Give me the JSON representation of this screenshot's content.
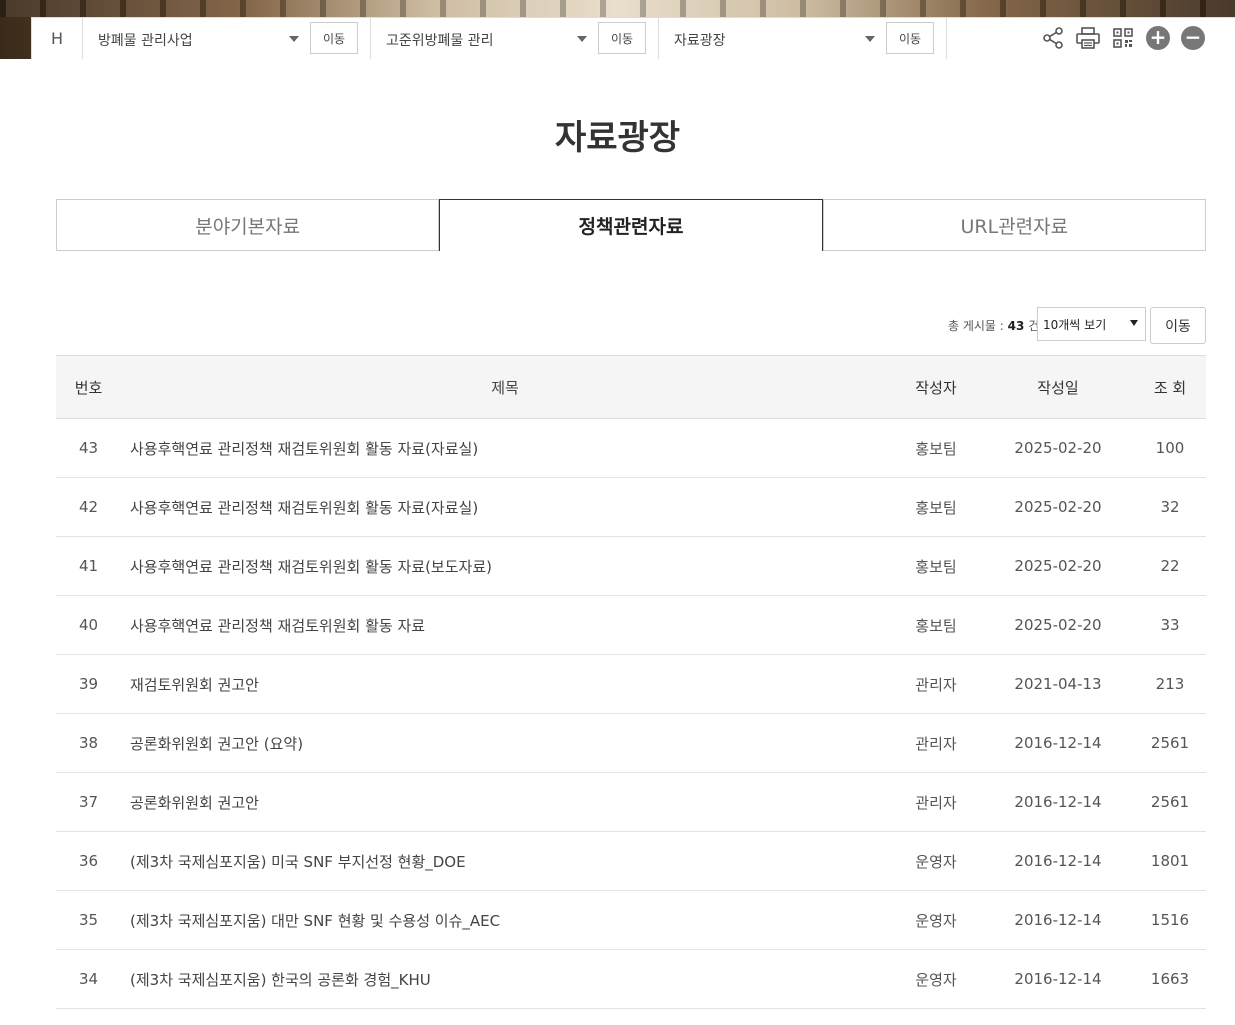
{
  "nav": {
    "home": "H",
    "selects": [
      {
        "label": "방폐물 관리사업",
        "go": "이동"
      },
      {
        "label": "고준위방폐물 관리",
        "go": "이동"
      },
      {
        "label": "자료광장",
        "go": "이동"
      }
    ],
    "zoom_in": "+",
    "zoom_out": "−"
  },
  "page_title": "자료광장",
  "tabs": [
    "분야기본자료",
    "정책관련자료",
    "URL관련자료"
  ],
  "list_info": {
    "prefix": "총 게시물 :",
    "count": "43",
    "suffix": "건",
    "page_size": "10개씩 보기",
    "go": "이동"
  },
  "table": {
    "headers": [
      "번호",
      "제목",
      "작성자",
      "작성일",
      "조 회"
    ],
    "rows": [
      {
        "no": "43",
        "title": "사용후핵연료 관리정책 재검토위원회 활동 자료(자료실)",
        "author": "홍보팀",
        "date": "2025-02-20",
        "views": "100"
      },
      {
        "no": "42",
        "title": "사용후핵연료 관리정책 재검토위원회 활동 자료(자료실)",
        "author": "홍보팀",
        "date": "2025-02-20",
        "views": "32"
      },
      {
        "no": "41",
        "title": "사용후핵연료 관리정책 재검토위원회 활동 자료(보도자료)",
        "author": "홍보팀",
        "date": "2025-02-20",
        "views": "22"
      },
      {
        "no": "40",
        "title": "사용후핵연료 관리정책 재검토위원회 활동 자료",
        "author": "홍보팀",
        "date": "2025-02-20",
        "views": "33"
      },
      {
        "no": "39",
        "title": "재검토위원회 권고안",
        "author": "관리자",
        "date": "2021-04-13",
        "views": "213"
      },
      {
        "no": "38",
        "title": "공론화위원회 권고안 (요약)",
        "author": "관리자",
        "date": "2016-12-14",
        "views": "2561"
      },
      {
        "no": "37",
        "title": "공론화위원회 권고안",
        "author": "관리자",
        "date": "2016-12-14",
        "views": "2561"
      },
      {
        "no": "36",
        "title": "(제3차 국제심포지움) 미국 SNF 부지선정 현황_DOE",
        "author": "운영자",
        "date": "2016-12-14",
        "views": "1801"
      },
      {
        "no": "35",
        "title": "(제3차 국제심포지움) 대만 SNF 현황 및 수용성 이슈_AEC",
        "author": "운영자",
        "date": "2016-12-14",
        "views": "1516"
      },
      {
        "no": "34",
        "title": "(제3차 국제심포지움) 한국의 공론화 경험_KHU",
        "author": "운영자",
        "date": "2016-12-14",
        "views": "1663"
      }
    ]
  }
}
